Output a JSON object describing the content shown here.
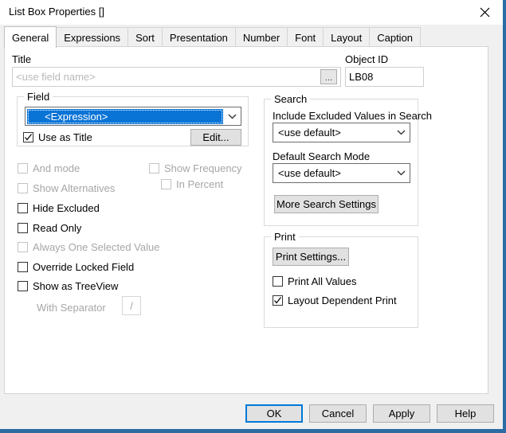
{
  "window": {
    "title": "List Box Properties []",
    "close_icon": "close-icon",
    "accent_color": "#2b6ca3",
    "focus_color": "#0078d7",
    "highlight_color": "#0a74d6"
  },
  "tabs": [
    {
      "label": "General",
      "active": true
    },
    {
      "label": "Expressions",
      "active": false
    },
    {
      "label": "Sort",
      "active": false
    },
    {
      "label": "Presentation",
      "active": false
    },
    {
      "label": "Number",
      "active": false
    },
    {
      "label": "Font",
      "active": false
    },
    {
      "label": "Layout",
      "active": false
    },
    {
      "label": "Caption",
      "active": false
    }
  ],
  "general": {
    "title_label": "Title",
    "title_value": "",
    "title_placeholder": "<use field name>",
    "title_browse_label": "...",
    "object_id_label": "Object ID",
    "object_id_value": "LB08",
    "field_group": {
      "label": "Field",
      "combo_value": "<Expression>",
      "use_as_title": {
        "label": "Use as Title",
        "checked": true,
        "enabled": true
      },
      "edit_button": "Edit..."
    },
    "options": [
      {
        "label": "And mode",
        "checked": false,
        "enabled": false
      },
      {
        "label": "Show Alternatives",
        "checked": false,
        "enabled": false
      },
      {
        "label": "Hide Excluded",
        "checked": false,
        "enabled": true
      },
      {
        "label": "Read Only",
        "checked": false,
        "enabled": true
      },
      {
        "label": "Always One Selected Value",
        "checked": false,
        "enabled": false
      },
      {
        "label": "Override Locked Field",
        "checked": false,
        "enabled": true
      },
      {
        "label": "Show as TreeView",
        "checked": false,
        "enabled": true
      }
    ],
    "options_right": [
      {
        "label": "Show Frequency",
        "checked": false,
        "enabled": false
      },
      {
        "label": "In Percent",
        "checked": false,
        "enabled": false
      }
    ],
    "with_separator": {
      "label": "With Separator",
      "value": "/",
      "enabled": false
    },
    "search_group": {
      "label": "Search",
      "include_excluded_label": "Include Excluded Values in Search",
      "include_excluded_value": "<use default>",
      "default_search_mode_label": "Default Search Mode",
      "default_search_mode_value": "<use default>",
      "more_settings_button": "More Search Settings"
    },
    "print_group": {
      "label": "Print",
      "print_settings_button": "Print Settings...",
      "print_all_values": {
        "label": "Print All Values",
        "checked": false,
        "enabled": true
      },
      "layout_dependent_print": {
        "label": "Layout Dependent Print",
        "checked": true,
        "enabled": true
      }
    }
  },
  "footer": {
    "ok": "OK",
    "cancel": "Cancel",
    "apply": "Apply",
    "help": "Help"
  }
}
